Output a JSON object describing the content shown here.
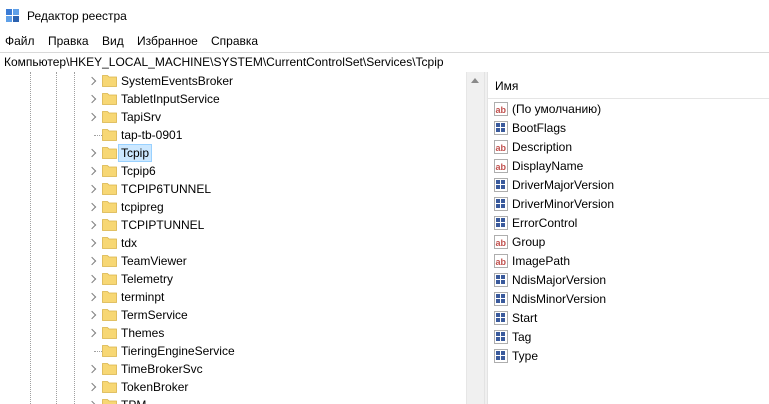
{
  "window": {
    "title": "Редактор реестра"
  },
  "menu": [
    "Файл",
    "Правка",
    "Вид",
    "Избранное",
    "Справка"
  ],
  "address": "Компьютер\\HKEY_LOCAL_MACHINE\\SYSTEM\\CurrentControlSet\\Services\\Tcpip",
  "tree": {
    "selected": "Tcpip",
    "items": [
      {
        "label": "SystemEventsBroker",
        "expandable": true
      },
      {
        "label": "TabletInputService",
        "expandable": true
      },
      {
        "label": "TapiSrv",
        "expandable": true
      },
      {
        "label": "tap-tb-0901",
        "expandable": false
      },
      {
        "label": "Tcpip",
        "expandable": true
      },
      {
        "label": "Tcpip6",
        "expandable": true
      },
      {
        "label": "TCPIP6TUNNEL",
        "expandable": true
      },
      {
        "label": "tcpipreg",
        "expandable": true
      },
      {
        "label": "TCPIPTUNNEL",
        "expandable": true
      },
      {
        "label": "tdx",
        "expandable": true
      },
      {
        "label": "TeamViewer",
        "expandable": true
      },
      {
        "label": "Telemetry",
        "expandable": true
      },
      {
        "label": "terminpt",
        "expandable": true
      },
      {
        "label": "TermService",
        "expandable": true
      },
      {
        "label": "Themes",
        "expandable": true
      },
      {
        "label": "TieringEngineService",
        "expandable": false
      },
      {
        "label": "TimeBrokerSvc",
        "expandable": true
      },
      {
        "label": "TokenBroker",
        "expandable": true
      },
      {
        "label": "TPM",
        "expandable": true
      }
    ]
  },
  "values": {
    "column_name": "Имя",
    "items": [
      {
        "name": "(По умолчанию)",
        "type": "string"
      },
      {
        "name": "BootFlags",
        "type": "binary"
      },
      {
        "name": "Description",
        "type": "string"
      },
      {
        "name": "DisplayName",
        "type": "string"
      },
      {
        "name": "DriverMajorVersion",
        "type": "binary"
      },
      {
        "name": "DriverMinorVersion",
        "type": "binary"
      },
      {
        "name": "ErrorControl",
        "type": "binary"
      },
      {
        "name": "Group",
        "type": "string"
      },
      {
        "name": "ImagePath",
        "type": "string"
      },
      {
        "name": "NdisMajorVersion",
        "type": "binary"
      },
      {
        "name": "NdisMinorVersion",
        "type": "binary"
      },
      {
        "name": "Start",
        "type": "binary"
      },
      {
        "name": "Tag",
        "type": "binary"
      },
      {
        "name": "Type",
        "type": "binary"
      }
    ]
  },
  "colors": {
    "selection_bg": "#cce8ff",
    "selection_border": "#99d1ff",
    "folder": "#f7d774",
    "string_icon": "#c0504d",
    "binary_icon": "#3a5a9c"
  }
}
